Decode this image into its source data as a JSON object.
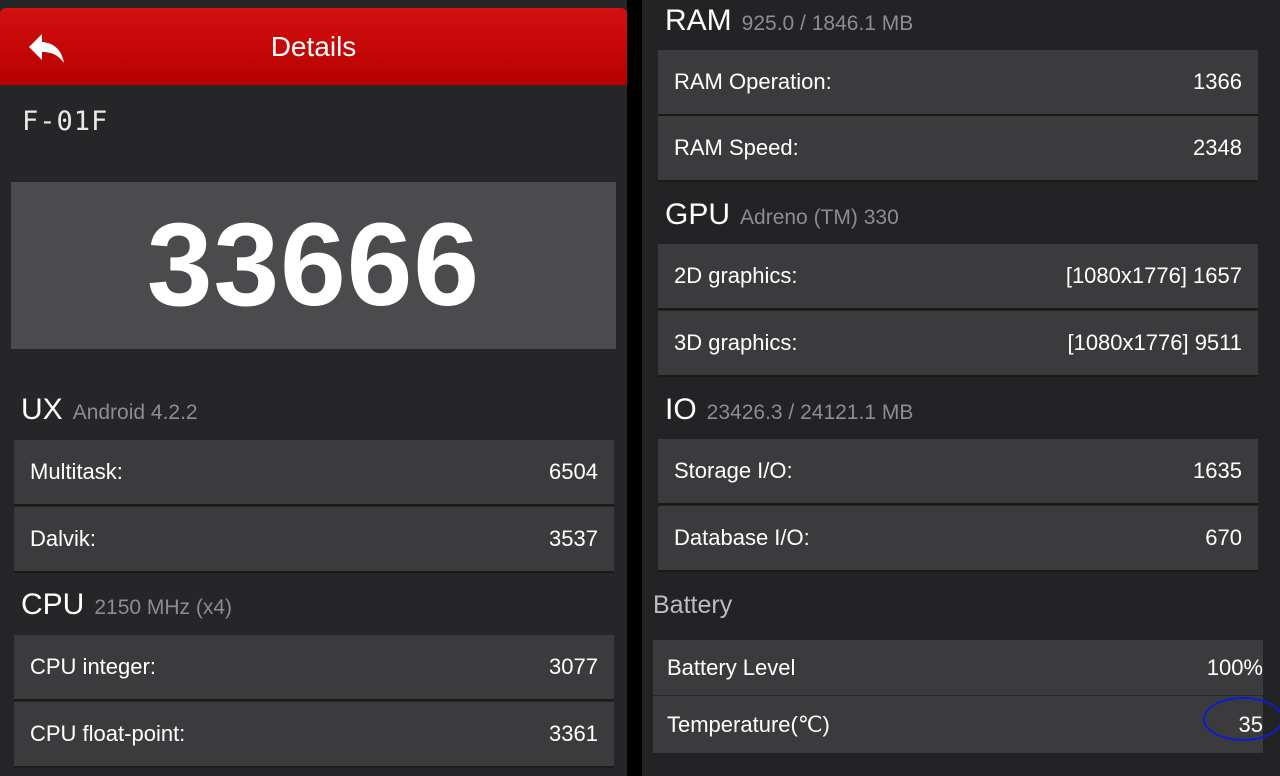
{
  "header": {
    "title": "Details",
    "back_icon": "back-arrow-icon",
    "accent_color": "#c40808"
  },
  "device": {
    "model": "F-01F"
  },
  "score": {
    "total": "33666"
  },
  "sections": {
    "ux": {
      "name": "UX",
      "sub": "Android 4.2.2",
      "rows": [
        {
          "label": "Multitask:",
          "value": "6504"
        },
        {
          "label": "Dalvik:",
          "value": "3537"
        }
      ]
    },
    "cpu": {
      "name": "CPU",
      "sub": "2150 MHz (x4)",
      "rows": [
        {
          "label": "CPU integer:",
          "value": "3077"
        },
        {
          "label": "CPU float-point:",
          "value": "3361"
        }
      ]
    },
    "ram": {
      "name": "RAM",
      "sub": "925.0 / 1846.1 MB",
      "rows": [
        {
          "label": "RAM Operation:",
          "value": "1366"
        },
        {
          "label": "RAM Speed:",
          "value": "2348"
        }
      ]
    },
    "gpu": {
      "name": "GPU",
      "sub": "Adreno (TM) 330",
      "rows": [
        {
          "label": "2D graphics:",
          "value": "[1080x1776] 1657"
        },
        {
          "label": "3D graphics:",
          "value": "[1080x1776] 9511"
        }
      ]
    },
    "io": {
      "name": "IO",
      "sub": "23426.3 / 24121.1 MB",
      "rows": [
        {
          "label": "Storage I/O:",
          "value": "1635"
        },
        {
          "label": "Database I/O:",
          "value": "670"
        }
      ]
    },
    "battery": {
      "name": "Battery",
      "rows": [
        {
          "label": "Battery Level",
          "value": "100%"
        },
        {
          "label": "Temperature(℃)",
          "value": "35"
        }
      ]
    }
  }
}
